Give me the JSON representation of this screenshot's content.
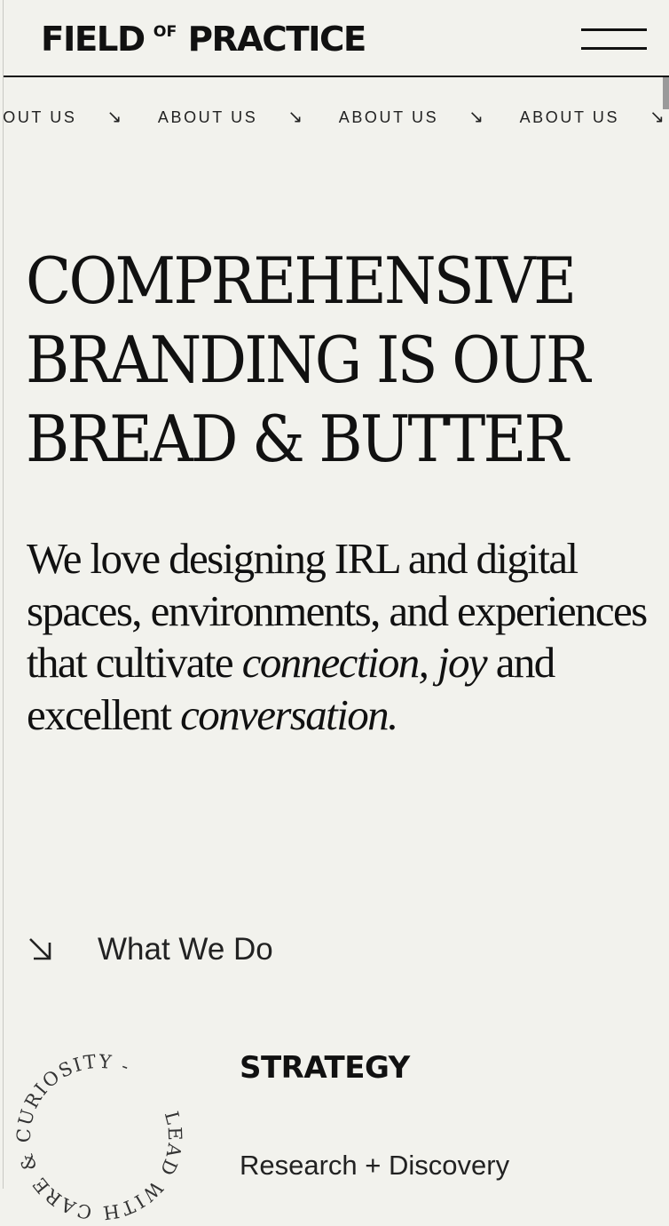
{
  "header": {
    "logo_left": "FIELD",
    "logo_of": "OF",
    "logo_right": "PRACTICE",
    "menu_icon": "hamburger-menu-icon"
  },
  "ticker": {
    "label": "ABOUT US",
    "arrow": "↘",
    "arrow_icon": "arrow-down-right-icon"
  },
  "hero": {
    "headline_lines": [
      "COMPREHENSIVE",
      "BRANDING IS OUR",
      "BREAD & BUTTER"
    ],
    "intro_plain_1": "We love designing IRL and digital spaces, environments, and experiences that cultivate",
    "intro_em_1": "connection, joy",
    "intro_plain_2": "and excellent",
    "intro_em_2": "conversation."
  },
  "what_we_do": {
    "label": "What We Do",
    "arrow_icon": "arrow-down-right-icon"
  },
  "badge": {
    "text": "LEAD WITH CARE & CURIOSITY - "
  },
  "services": {
    "heading": "STRATEGY",
    "items": [
      "Research + Discovery"
    ]
  },
  "colors": {
    "background": "#f2f2ed",
    "text": "#111111"
  }
}
